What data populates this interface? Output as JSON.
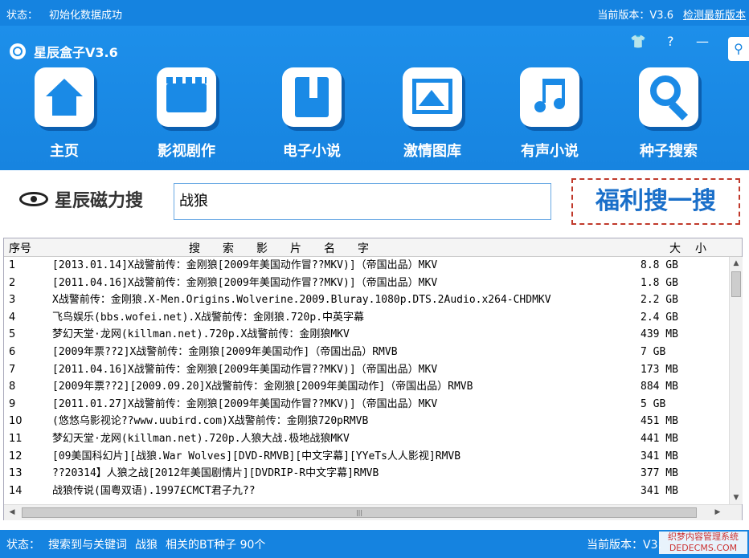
{
  "topbar": {
    "status_label": "状态：",
    "status_text": "初始化数据成功",
    "version_label": "当前版本：V3.6",
    "check_update": "检测最新版本"
  },
  "header": {
    "app_title": "星辰盒子V3.6",
    "help": "?",
    "minimize": "—"
  },
  "nav": [
    {
      "label": "主页",
      "icon": "home-icon"
    },
    {
      "label": "影视剧作",
      "icon": "film-icon"
    },
    {
      "label": "电子小说",
      "icon": "book-icon"
    },
    {
      "label": "激情图库",
      "icon": "picture-icon"
    },
    {
      "label": "有声小说",
      "icon": "music-icon"
    },
    {
      "label": "种子搜索",
      "icon": "search-icon"
    }
  ],
  "search": {
    "brand": "星辰磁力搜",
    "query": "战狼",
    "button": "福利搜一搜"
  },
  "table": {
    "headers": {
      "idx": "序号",
      "name": "搜索影片名字",
      "size": "大小"
    },
    "rows": [
      {
        "idx": "1",
        "name": "[2013.01.14]X战警前传：金刚狼[2009年美国动作冒??MKV)]（帝国出品）MKV",
        "size": "8.8 GB"
      },
      {
        "idx": "2",
        "name": "[2011.04.16]X战警前传：金刚狼[2009年美国动作冒??MKV)]（帝国出品）MKV",
        "size": "1.8 GB"
      },
      {
        "idx": "3",
        "name": "X战警前传：金刚狼.X-Men.Origins.Wolverine.2009.Bluray.1080p.DTS.2Audio.x264-CHDMKV",
        "size": "2.2 GB"
      },
      {
        "idx": "4",
        "name": "飞鸟娱乐(bbs.wofei.net).X战警前传：金刚狼.720p.中英字幕",
        "size": "2.4 GB"
      },
      {
        "idx": "5",
        "name": "梦幻天堂·龙网(killman.net).720p.X战警前传：金刚狼MKV",
        "size": "439 MB"
      },
      {
        "idx": "6",
        "name": "[2009年票??2]X战警前传：金刚狼[2009年美国动作]（帝国出品）RMVB",
        "size": "7 GB"
      },
      {
        "idx": "7",
        "name": "[2011.04.16]X战警前传：金刚狼[2009年美国动作冒??MKV)]（帝国出品）MKV",
        "size": "173 MB"
      },
      {
        "idx": "8",
        "name": "[2009年票??2][2009.09.20]X战警前传：金刚狼[2009年美国动作]（帝国出品）RMVB",
        "size": "884 MB"
      },
      {
        "idx": "9",
        "name": "[2011.01.27]X战警前传：金刚狼[2009年美国动作冒??MKV)]（帝国出品）MKV",
        "size": "5 GB"
      },
      {
        "idx": "10",
        "name": "(悠悠乌影视论??www.uubird.com)X战警前传：金刚狼720pRMVB",
        "size": "451 MB"
      },
      {
        "idx": "11",
        "name": "梦幻天堂·龙网(killman.net).720p.人狼大战.极地战狼MKV",
        "size": "441 MB"
      },
      {
        "idx": "12",
        "name": "[09美国科幻片][战狼.War Wolves][DVD-RMVB][中文字幕][YYeTs人人影视]RMVB",
        "size": "341 MB"
      },
      {
        "idx": "13",
        "name": "??20314】人狼之战[2012年美国剧情片][DVDRIP-R中文字幕]RMVB",
        "size": "377 MB"
      },
      {
        "idx": "14",
        "name": "战狼传说(国粤双语).1997£CMCT君子九??",
        "size": "341 MB"
      }
    ]
  },
  "bottombar": {
    "status_label": "状态：",
    "status_text": "搜索到与关键词",
    "keyword": "战狼",
    "suffix": "相关的BT种子 90个",
    "version_label": "当前版本：V3.",
    "watermark": "织梦内容管理系统 DEDECMS.COM"
  },
  "colors": {
    "accent": "#1583e0",
    "highlight": "#c0392b"
  }
}
